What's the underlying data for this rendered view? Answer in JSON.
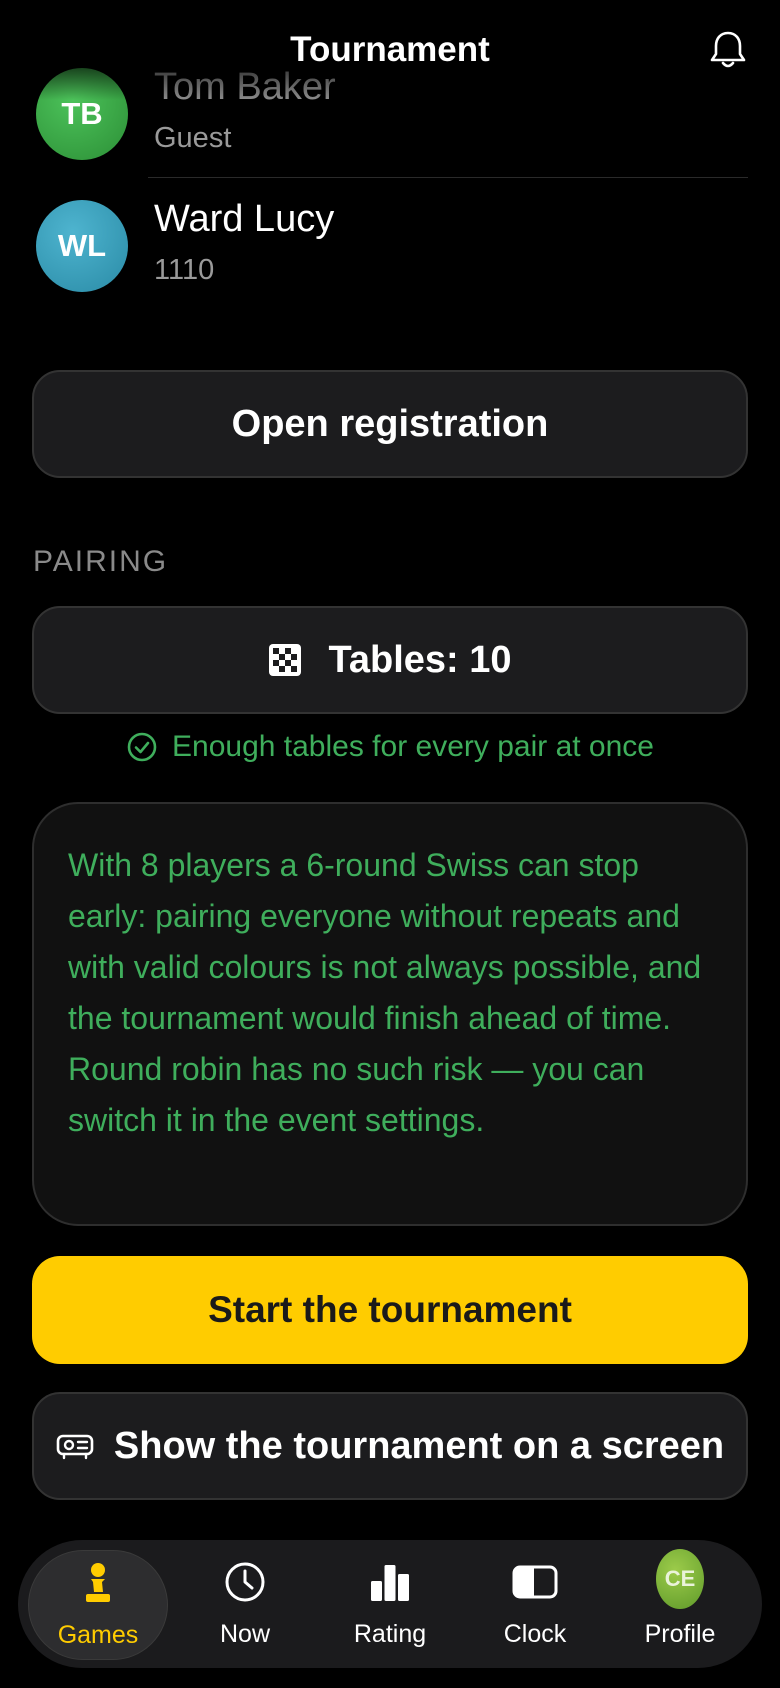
{
  "header": {
    "title": "Tournament",
    "bell_icon": "bell-icon"
  },
  "players": [
    {
      "initials": "TB",
      "name": "Tom Baker",
      "sub": "Guest",
      "color": "#3aa845"
    },
    {
      "initials": "WL",
      "name": "Ward Lucy",
      "sub": "1110",
      "color": "#3a9cb8"
    }
  ],
  "registration": {
    "label": "Open registration"
  },
  "pairing": {
    "section_label": "PAIRING",
    "tables_label": "Tables: 10",
    "tables_icon": "chessboard-icon",
    "ok_text": "Enough tables for every pair at once",
    "ok_icon": "check-circle-icon",
    "note": "With 8 players a 6-round Swiss can stop early: pairing everyone without repeats and with valid colours is not always possible, and the tournament would finish ahead of time. Round robin has no such risk — you can switch it in the event settings."
  },
  "actions": {
    "start_label": "Start the tournament",
    "screen_label": "Show the tournament on a screen",
    "screen_icon": "projector-icon"
  },
  "nav": {
    "items": [
      {
        "label": "Games",
        "icon": "pawn-icon"
      },
      {
        "label": "Now",
        "icon": "clock-icon"
      },
      {
        "label": "Rating",
        "icon": "bar-chart-icon"
      },
      {
        "label": "Clock",
        "icon": "chess-clock-icon"
      },
      {
        "label": "Profile",
        "icon": "avatar"
      }
    ],
    "profile_initials": "CE"
  },
  "colors": {
    "accent": "#ffcc00",
    "success": "#3fae5c",
    "background": "#000000"
  }
}
